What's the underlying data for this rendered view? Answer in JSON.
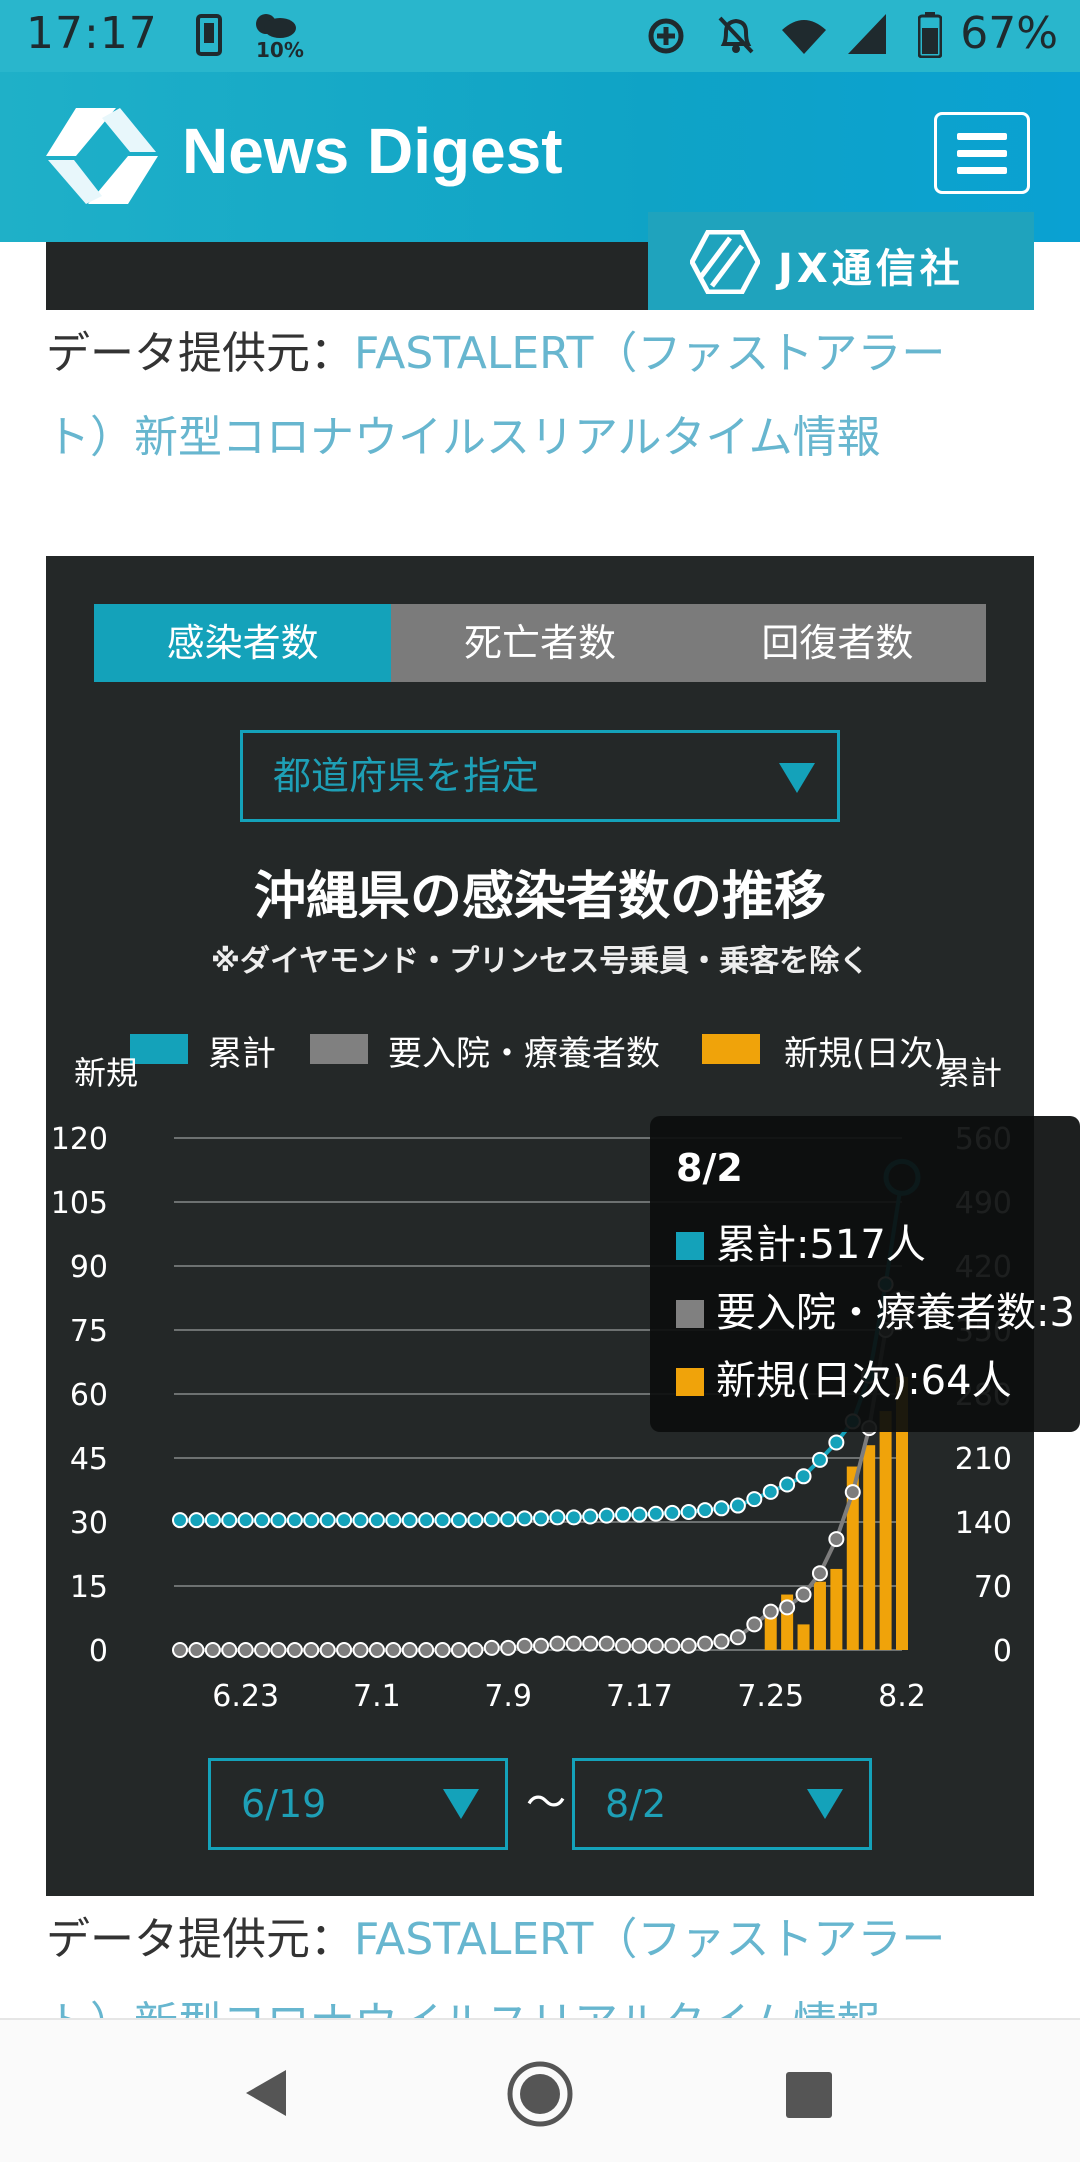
{
  "status_bar": {
    "time": "17:17",
    "weather_chance": "10%",
    "battery": "67%",
    "icons": [
      "phone-icon",
      "weather-icon",
      "data-saver-icon",
      "bell-off-icon",
      "wifi-icon",
      "signal-icon",
      "battery-icon"
    ]
  },
  "header": {
    "brand": "News Digest",
    "banner_badge": "JX通信社",
    "colors": {
      "header": "#0fa3c6",
      "accent": "#14a2ba"
    }
  },
  "source_1": {
    "prefix": "データ提供元：",
    "link_line1": "FASTALERT（ファストアラー",
    "link_line2": "ト）新型コロナウイルスリアルタイム情報"
  },
  "panel": {
    "tabs": [
      {
        "label": "感染者数",
        "active": true
      },
      {
        "label": "死亡者数",
        "active": false
      },
      {
        "label": "回復者数",
        "active": false
      }
    ],
    "prefecture_select": {
      "placeholder": "都道府県を指定"
    },
    "date_from": "6/19",
    "date_to": "8/2",
    "range_separator": "〜"
  },
  "chart_data": {
    "type": "bar+line",
    "title": "沖縄県の感染者数の推移",
    "subtitle": "※ダイヤモンド・プリンセス号乗員・乗客を除く",
    "legend": [
      {
        "name": "累計",
        "color": "#14a2ba"
      },
      {
        "name": "要入院・療養者数",
        "color": "#808080"
      },
      {
        "name": "新規(日次)",
        "color": "#f0a30a"
      }
    ],
    "left_axis_label": "新規",
    "right_axis_label": "累計",
    "left_ticks": [
      "0",
      "15",
      "30",
      "45",
      "60",
      "75",
      "90",
      "105",
      "120"
    ],
    "right_ticks": [
      "0",
      "70",
      "140",
      "210",
      "280",
      "350",
      "420",
      "490",
      "560"
    ],
    "left_range": [
      0,
      120
    ],
    "right_range": [
      0,
      560
    ],
    "x_tick_labels": [
      "6.23",
      "7.1",
      "7.9",
      "7.17",
      "7.25",
      "8.2"
    ],
    "dates": [
      "6/19",
      "6/20",
      "6/21",
      "6/22",
      "6/23",
      "6/24",
      "6/25",
      "6/26",
      "6/27",
      "6/28",
      "6/29",
      "6/30",
      "7/1",
      "7/2",
      "7/3",
      "7/4",
      "7/5",
      "7/6",
      "7/7",
      "7/8",
      "7/9",
      "7/10",
      "7/11",
      "7/12",
      "7/13",
      "7/14",
      "7/15",
      "7/16",
      "7/17",
      "7/18",
      "7/19",
      "7/20",
      "7/21",
      "7/22",
      "7/23",
      "7/24",
      "7/25",
      "7/26",
      "7/27",
      "7/28",
      "7/29",
      "7/30",
      "7/31",
      "8/1",
      "8/2"
    ],
    "series": [
      {
        "name": "累計",
        "axis": "right",
        "values": [
          142,
          142,
          142,
          142,
          142,
          142,
          142,
          142,
          142,
          142,
          142,
          142,
          142,
          142,
          142,
          142,
          142,
          142,
          142,
          143,
          143,
          144,
          144,
          145,
          145,
          146,
          147,
          148,
          148,
          149,
          150,
          151,
          153,
          155,
          158,
          165,
          173,
          181,
          190,
          208,
          227,
          250,
          300,
          400,
          517
        ]
      },
      {
        "name": "要入院・療養者数",
        "axis": "left",
        "values": [
          0,
          0,
          0,
          0,
          0,
          0,
          0,
          0,
          0,
          0,
          0,
          0,
          0,
          0,
          0,
          0,
          0,
          0,
          0,
          0.5,
          0.5,
          1,
          1,
          1.5,
          1.5,
          1.5,
          1.5,
          1,
          1,
          1,
          1,
          1,
          1.5,
          2,
          3,
          6,
          9,
          10,
          13,
          18,
          26,
          37,
          52,
          75,
          80
        ]
      },
      {
        "name": "新規(日次)",
        "axis": "left",
        "values": [
          0,
          0,
          0,
          0,
          0,
          0,
          0,
          0,
          0,
          0,
          0,
          0,
          0,
          0,
          0,
          0,
          0,
          0,
          0,
          0,
          0,
          0,
          0,
          0,
          0,
          0,
          0,
          0,
          0,
          0,
          0,
          0,
          0,
          0,
          0,
          0,
          9,
          13,
          6,
          16,
          19,
          43,
          48,
          56,
          64
        ]
      }
    ],
    "tooltip": {
      "date": "8/2",
      "rows": [
        "累計:517人",
        "要入院・療養者数:3",
        "新規(日次):64人"
      ]
    }
  },
  "source_2": {
    "prefix": "データ提供元：",
    "link_line1": "FASTALERT（ファストアラー",
    "link_line2": "ト）新型コロナウイルスリアルタイム情報"
  },
  "nav": {
    "icons": [
      "back-icon",
      "home-icon",
      "recents-icon"
    ]
  }
}
